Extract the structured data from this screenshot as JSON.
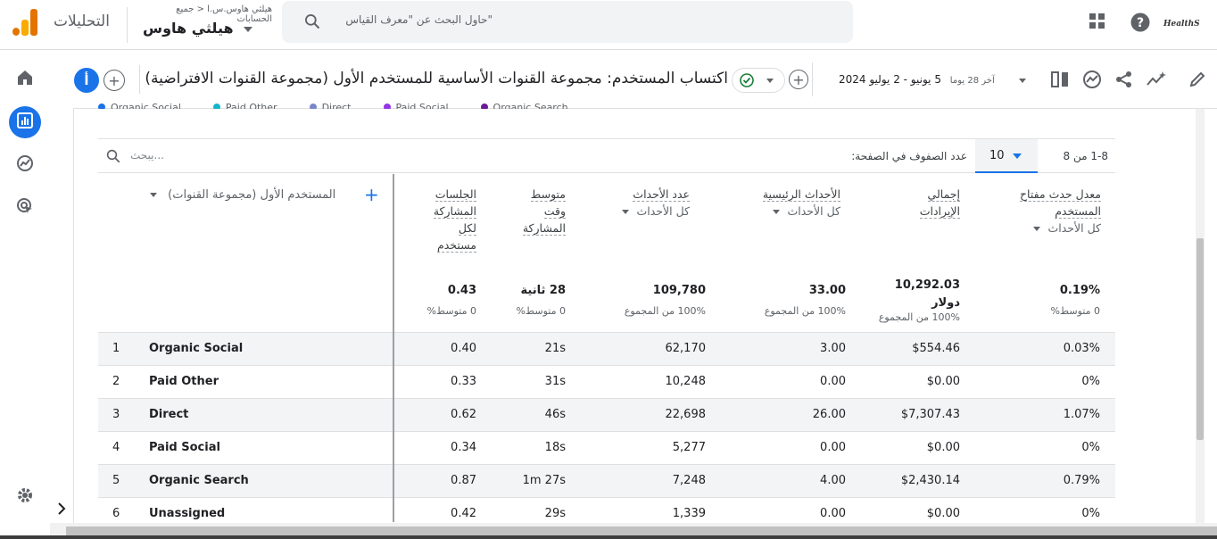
{
  "topbar": {
    "app_name": "التحليلات",
    "account_crumb": "هيلثي هاوس.س.ا < جميع الحسابات",
    "account_name": "هيلثي هاوس",
    "search_placeholder": "حاول البحث عن \"معرف القياس\"",
    "brand_logo_text": "HealthS"
  },
  "report": {
    "title": "اكتساب المستخدم: مجموعة القنوات الأساسية للمستخدم الأول (مجموعة القنوات الافتراضية)",
    "date_range_label": "آخر 28 يوما",
    "date_range": "5 يونيو - 2 يوليو 2024",
    "avatar_letter": "أ"
  },
  "legend": [
    "Organic Social",
    "Paid Other",
    "Direct",
    "Paid Social",
    "Organic Search"
  ],
  "legend_colors": [
    "#1a73e8",
    "#12b5cb",
    "#7986cb",
    "#9334e6",
    "#6a1b9a"
  ],
  "toolbar": {
    "search_placeholder": "يبحث...",
    "rows_per_page_label": "عدد الصفوف في الصفحة:",
    "rows_per_page_value": "10",
    "pager": "1-8 من 8"
  },
  "table": {
    "dimension_header": "المستخدم الأول (مجموعة القنوات)",
    "columns": [
      {
        "name": "معدل حدث مفتاح المستخدم",
        "sub": "كل الأحداث",
        "total": "0.19%",
        "total_sub": "0 متوسط%"
      },
      {
        "name": "إجمالي الإيرادات",
        "sub": "",
        "total": "10,292.03 دولار",
        "total_sub": "100% من المجموع"
      },
      {
        "name": "الأحداث الرئيسية",
        "sub": "كل الأحداث",
        "total": "33.00",
        "total_sub": "100% من المجموع"
      },
      {
        "name": "عدد الأحداث",
        "sub": "كل الأحداث",
        "total": "109,780",
        "total_sub": "100% من المجموع"
      },
      {
        "name": "متوسط وقت المشاركة",
        "sub": "",
        "total": "28 ثانية",
        "total_sub": "0 متوسط%"
      },
      {
        "name": "الجلسات المشاركة لكل مستخدم",
        "sub": "",
        "total": "0.43",
        "total_sub": "0 متوسط%"
      }
    ],
    "rows": [
      {
        "idx": "1",
        "channel": "Organic Social",
        "eng_sessions": "0.40",
        "eng_time": "21s",
        "events": "62,170",
        "key_events": "3.00",
        "revenue": "$554.46",
        "key_rate": "0.03%"
      },
      {
        "idx": "2",
        "channel": "Paid Other",
        "eng_sessions": "0.33",
        "eng_time": "31s",
        "events": "10,248",
        "key_events": "0.00",
        "revenue": "$0.00",
        "key_rate": "0%"
      },
      {
        "idx": "3",
        "channel": "Direct",
        "eng_sessions": "0.62",
        "eng_time": "46s",
        "events": "22,698",
        "key_events": "26.00",
        "revenue": "$7,307.43",
        "key_rate": "1.07%"
      },
      {
        "idx": "4",
        "channel": "Paid Social",
        "eng_sessions": "0.34",
        "eng_time": "18s",
        "events": "5,277",
        "key_events": "0.00",
        "revenue": "$0.00",
        "key_rate": "0%"
      },
      {
        "idx": "5",
        "channel": "Organic Search",
        "eng_sessions": "0.87",
        "eng_time": "1m 27s",
        "events": "7,248",
        "key_events": "4.00",
        "revenue": "$2,430.14",
        "key_rate": "0.79%"
      },
      {
        "idx": "6",
        "channel": "Unassigned",
        "eng_sessions": "0.42",
        "eng_time": "29s",
        "events": "1,339",
        "key_events": "0.00",
        "revenue": "$0.00",
        "key_rate": "0%"
      }
    ]
  }
}
